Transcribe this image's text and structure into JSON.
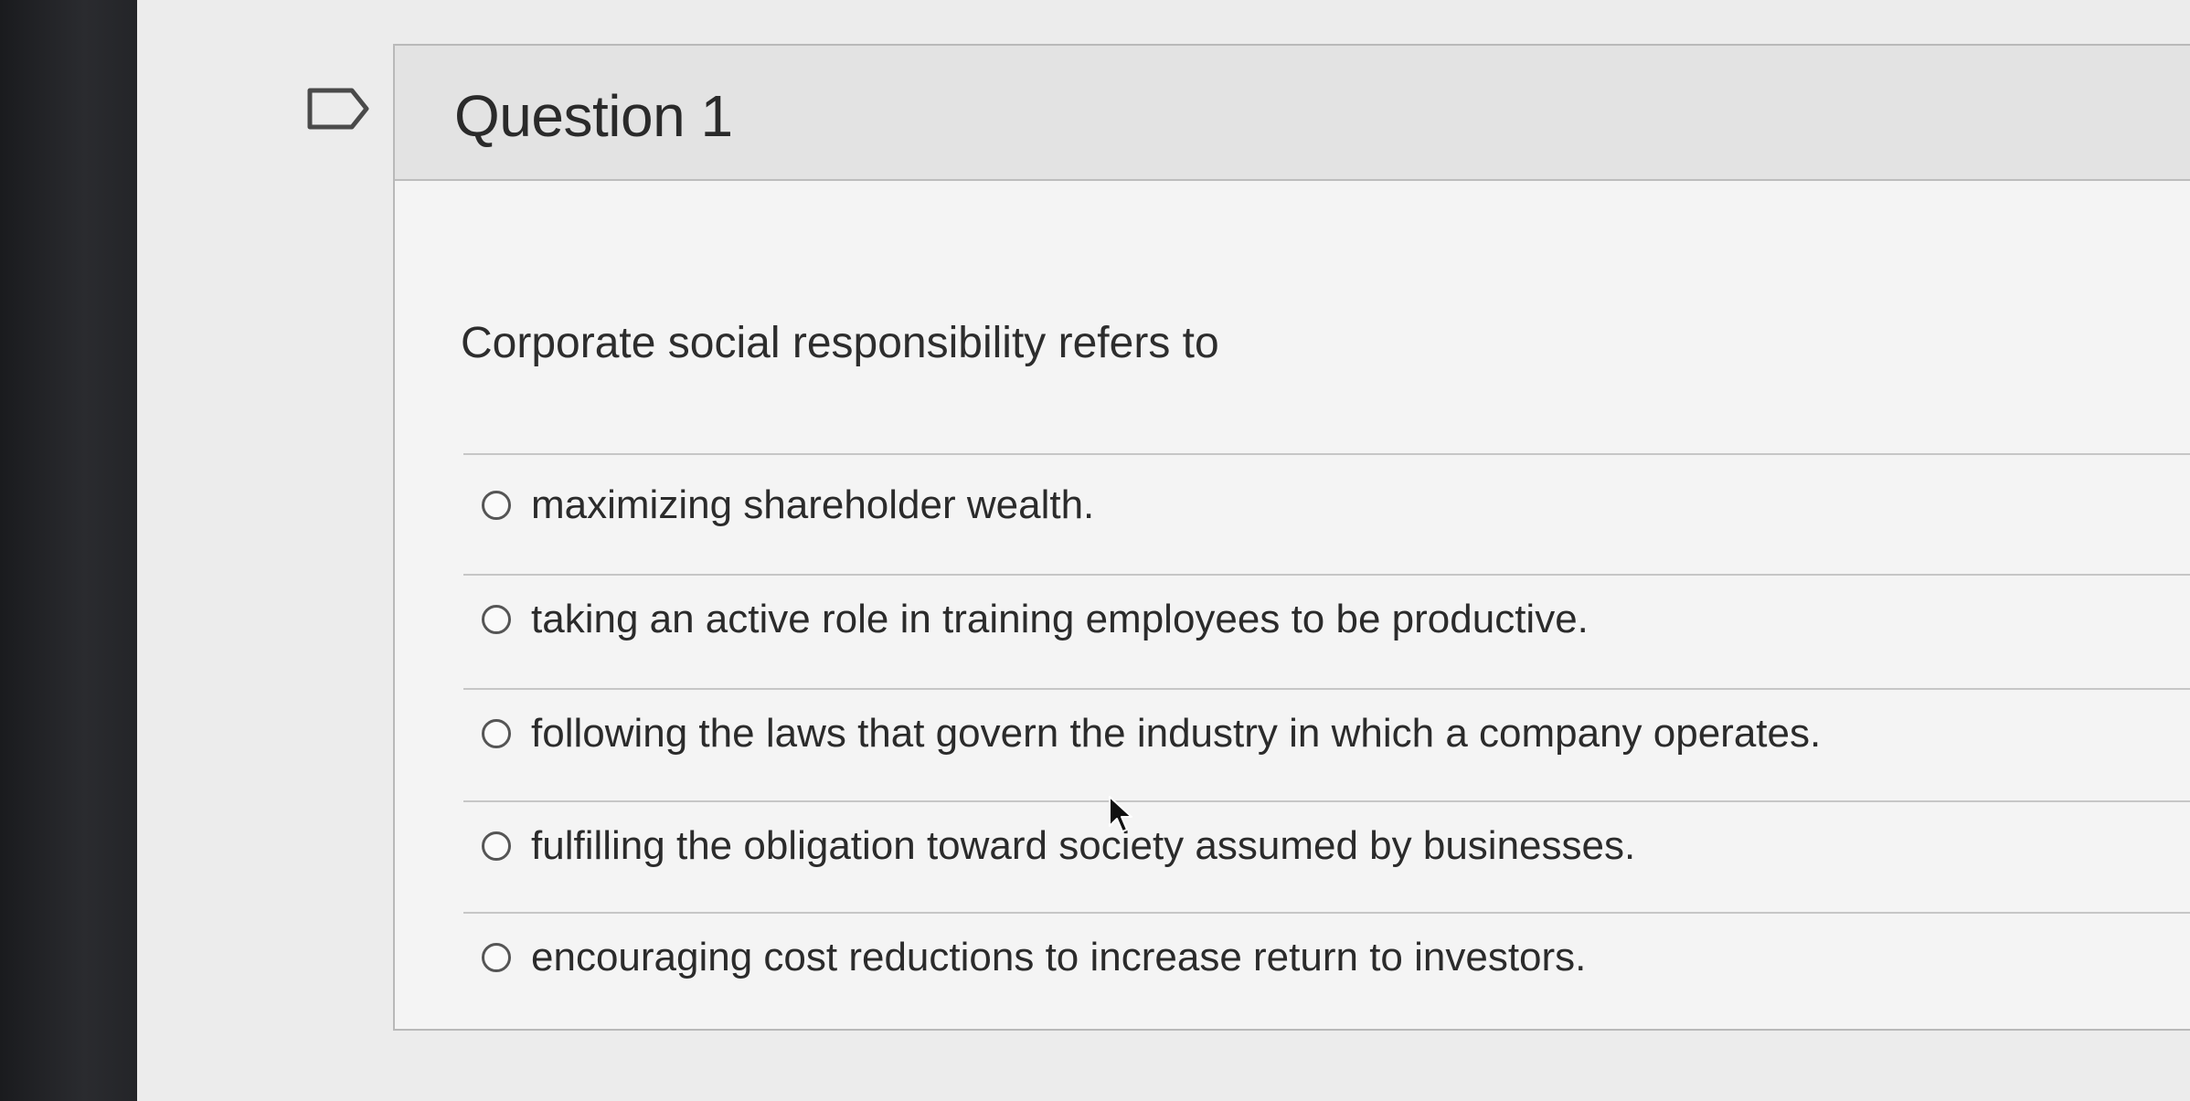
{
  "question": {
    "title": "Question 1",
    "prompt": "Corporate social responsibility refers to",
    "answers": [
      {
        "label": "maximizing shareholder wealth.",
        "selected": false
      },
      {
        "label": "taking an active role in training employees to be productive.",
        "selected": false
      },
      {
        "label": "following the laws that govern the industry in which a company operates.",
        "selected": false
      },
      {
        "label": "fulfilling the obligation toward society assumed by businesses.",
        "selected": false
      },
      {
        "label": "encouraging cost reductions to increase return to investors.",
        "selected": false
      }
    ]
  },
  "icons": {
    "flag": "flag-question-icon",
    "cursor": "mouse-pointer-icon"
  },
  "colors": {
    "text": "#2b2b2b",
    "header_bg": "#e3e3e3",
    "card_bg": "#f4f4f4",
    "border": "#b9b9b9"
  }
}
